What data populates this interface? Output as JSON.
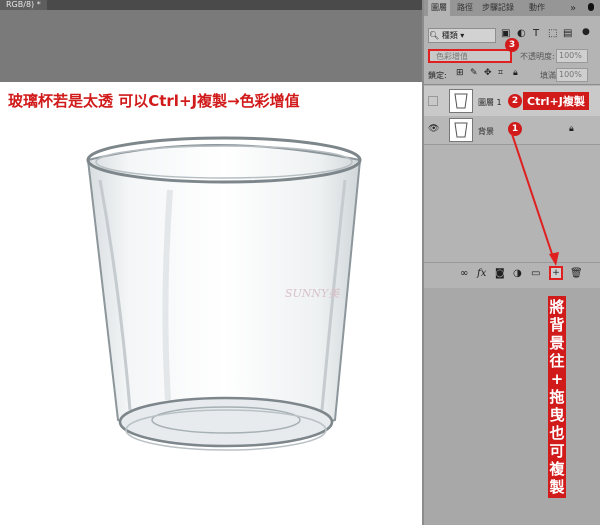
{
  "document": {
    "tab_title": "RGB/8) *"
  },
  "headline": "玻璃杯若是太透 可以Ctrl+J複製→色彩增值",
  "watermark": "SUNNY美",
  "panel": {
    "tabs": [
      "圖層",
      "路徑",
      "步驟記錄",
      "動作"
    ],
    "menu_glyph": "»",
    "filter_label": "種類",
    "blend_mode": "色彩增值",
    "opacity_label": "不透明度:",
    "opacity_value": "100%",
    "lock_label": "鎖定:",
    "fill_label": "填滿:",
    "fill_value": "100%",
    "layers": [
      {
        "name": "圖層 1",
        "visible": false,
        "selected": true
      },
      {
        "name": "背景",
        "visible": true,
        "locked": true
      }
    ],
    "bottom_icons": [
      "link-icon",
      "fx-icon",
      "mask-icon",
      "adjustment-icon",
      "folder-icon",
      "new-layer-icon",
      "trash-icon"
    ]
  },
  "annotations": {
    "badge1": "1",
    "badge2": "2",
    "badge3": "3",
    "callout2": "Ctrl+J複製",
    "vertical_note": "將背景往+拖曳也可複製"
  },
  "colors": {
    "accent": "#d11a1a",
    "panel_bg": "#b4b4b4",
    "canvas_gray": "#7a7a7a"
  }
}
